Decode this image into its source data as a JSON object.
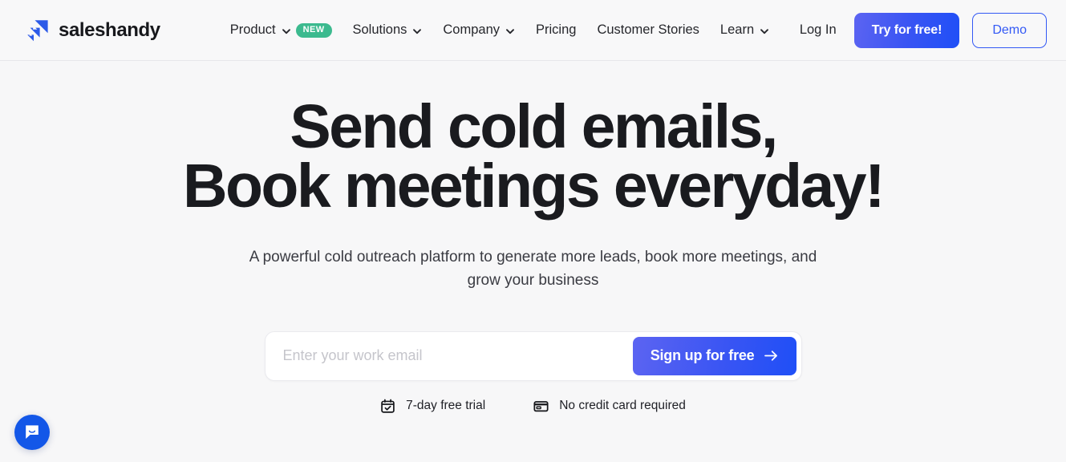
{
  "brand": {
    "name": "saleshandy",
    "logo_icon": "saleshandy-arrow-logo",
    "logo_color": "#2c5ae8"
  },
  "header": {
    "nav": [
      {
        "label": "Product",
        "has_chevron": true,
        "badge": "NEW"
      },
      {
        "label": "Solutions",
        "has_chevron": true,
        "badge": null
      },
      {
        "label": "Company",
        "has_chevron": true,
        "badge": null
      },
      {
        "label": "Pricing",
        "has_chevron": false,
        "badge": null
      },
      {
        "label": "Customer Stories",
        "has_chevron": false,
        "badge": null
      },
      {
        "label": "Learn",
        "has_chevron": true,
        "badge": null
      }
    ],
    "login_label": "Log In",
    "try_label": "Try for free!",
    "demo_label": "Demo",
    "badge_color": "#3cba8f",
    "accent_color": "#3359f5"
  },
  "hero": {
    "title_line1": "Send cold emails,",
    "title_line2": "Book meetings everyday!",
    "sub_line1": "A powerful cold outreach platform to generate more leads, book more meetings, and",
    "sub_line2": "grow your business"
  },
  "signup": {
    "placeholder": "Enter your work email",
    "value": "",
    "button_label": "Sign up for free",
    "button_icon": "arrow-right-icon"
  },
  "trust": [
    {
      "icon": "calendar-check-icon",
      "label": "7-day free trial"
    },
    {
      "icon": "credit-card-icon",
      "label": "No credit card required"
    }
  ],
  "chat": {
    "icon": "chat-bubble-smile-icon",
    "color": "#1357e8"
  }
}
